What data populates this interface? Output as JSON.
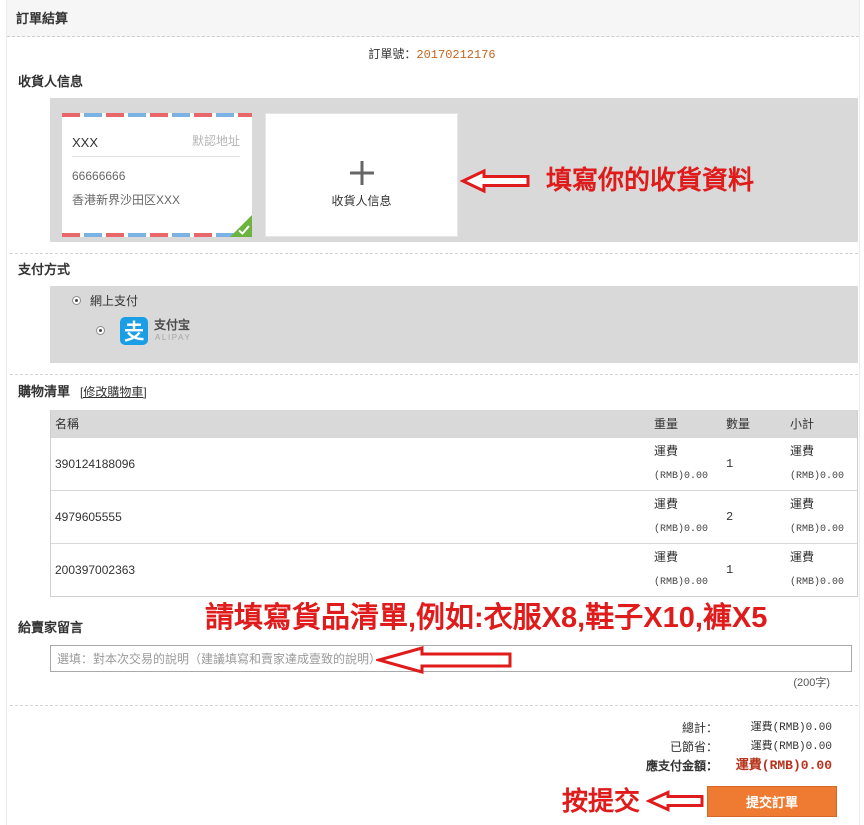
{
  "header": {
    "title": "訂單結算"
  },
  "order": {
    "number_label": "訂單號：",
    "number": "20170212176"
  },
  "consignee": {
    "section_title": "收貨人信息",
    "selected_card": {
      "name": "XXX",
      "default_label": "默認地址",
      "phone": "66666666",
      "address": "香港新界沙田区XXX",
      "selected": true,
      "selected_icon": "check-icon"
    },
    "add_card": {
      "label": "收貨人信息",
      "icon": "plus-icon"
    }
  },
  "payment": {
    "section_title": "支付方式",
    "online": {
      "label": "網上支付",
      "selected": true
    },
    "alipay": {
      "name": "支付宝",
      "sub": "ALIPAY",
      "selected": true,
      "logo_icon": "alipay-logo-icon"
    }
  },
  "cart": {
    "section_title": "購物清單",
    "edit_link": "[修改購物車]",
    "columns": [
      "名稱",
      "重量",
      "數量",
      "小計"
    ],
    "rows": [
      {
        "name": "390124188096",
        "weight_label": "運費",
        "weight_value": "(RMB)0.00",
        "quantity": "1",
        "subtotal_label": "運費",
        "subtotal_value": "(RMB)0.00"
      },
      {
        "name": "4979605555",
        "weight_label": "運費",
        "weight_value": "(RMB)0.00",
        "quantity": "2",
        "subtotal_label": "運費",
        "subtotal_value": "(RMB)0.00"
      },
      {
        "name": "200397002363",
        "weight_label": "運費",
        "weight_value": "(RMB)0.00",
        "quantity": "1",
        "subtotal_label": "運費",
        "subtotal_value": "(RMB)0.00"
      }
    ]
  },
  "message": {
    "section_title": "給賣家留言",
    "placeholder": "選填：對本次交易的說明（建議填寫和賣家達成壹致的說明）",
    "limit": "(200字)"
  },
  "summary": {
    "total_label": "總計：",
    "total_value": "運費(RMB)0.00",
    "saved_label": "已節省：",
    "saved_value": "運費(RMB)0.00",
    "due_label": "應支付金額：",
    "due_value": "運費(RMB)0.00"
  },
  "submit": {
    "label": "提交訂單"
  },
  "annotations": {
    "consignee_hint": "填寫你的收貨資料",
    "cart_hint": "請填寫貨品清單,例如:衣服X8,鞋子X10,褲X5",
    "submit_hint": "按提交",
    "arrow_icon": "arrow-left-icon"
  },
  "colors": {
    "panel_gray": "#d9d9d9",
    "accent_orange": "#ee7b31",
    "annotation_red": "#e01b1b",
    "order_number": "#c4661f",
    "amount_due": "#b8331c",
    "check_green": "#6db33f",
    "alipay_blue": "#1a9fe6"
  }
}
